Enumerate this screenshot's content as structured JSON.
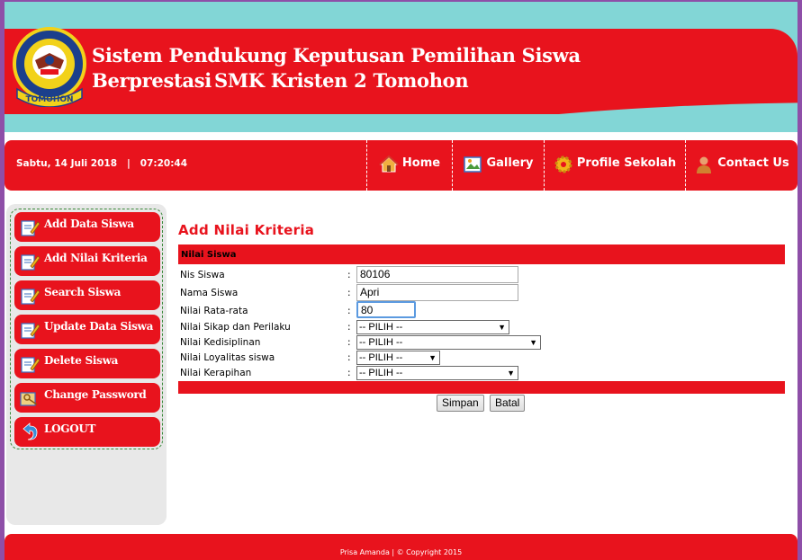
{
  "header": {
    "title": "Sistem Pendukung Keputusan Pemilihan Siswa Berprestasi",
    "subtitle": "SMK Kristen 2 Tomohon",
    "logo_text": "TOMOHON"
  },
  "navbar": {
    "datetime": "Sabtu, 14 Juli 2018   |   07:20:44",
    "items": [
      {
        "label": "Home",
        "icon": "home-icon"
      },
      {
        "label": "Gallery",
        "icon": "gallery-icon"
      },
      {
        "label": "Profile Sekolah",
        "icon": "gear-icon"
      },
      {
        "label": "Contact Us",
        "icon": "user-icon"
      }
    ]
  },
  "sidebar": {
    "items": [
      {
        "label": "Add Data Siswa",
        "icon": "edit-icon"
      },
      {
        "label": "Add Nilai Kriteria",
        "icon": "edit-icon"
      },
      {
        "label": "Search Siswa",
        "icon": "edit-icon"
      },
      {
        "label": "Update Data Siswa",
        "icon": "edit-icon"
      },
      {
        "label": "Delete Siswa",
        "icon": "edit-icon"
      },
      {
        "label": "Change Password",
        "icon": "key-icon"
      },
      {
        "label": "LOGOUT",
        "icon": "logout-icon"
      }
    ]
  },
  "form": {
    "heading": "Add Nilai Kriteria",
    "section_title": "Nilai Siswa",
    "fields": {
      "nis": {
        "label": "Nis Siswa",
        "value": "80106"
      },
      "nama": {
        "label": "Nama Siswa",
        "value": "Apri"
      },
      "rata": {
        "label": "Nilai Rata-rata",
        "value": "80"
      },
      "sikap": {
        "label": "Nilai Sikap dan Perilaku",
        "value": "-- PILIH --"
      },
      "disiplin": {
        "label": "Nilai Kedisiplinan",
        "value": "-- PILIH --"
      },
      "loyalitas": {
        "label": "Nilai Loyalitas siswa",
        "value": "-- PILIH --"
      },
      "kerapihan": {
        "label": "Nilai Kerapihan",
        "value": "-- PILIH --"
      }
    },
    "colon": ":",
    "buttons": {
      "save": "Simpan",
      "cancel": "Batal"
    }
  },
  "footer": {
    "text": "Prisa Amanda | © Copyright 2015"
  },
  "colors": {
    "primary_red": "#e8131d",
    "teal": "#82d6d6",
    "window_frame": "#8e4fa8"
  }
}
